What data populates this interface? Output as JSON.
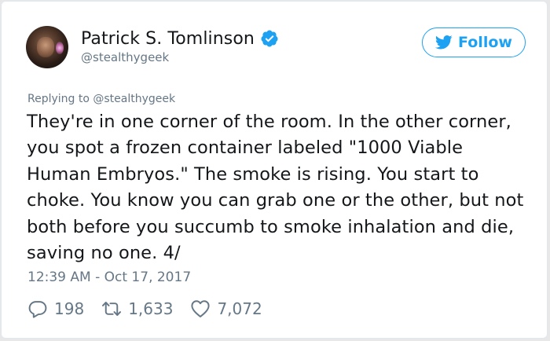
{
  "author": {
    "name": "Patrick S. Tomlinson",
    "handle": "@stealthygeek",
    "verified": true
  },
  "follow_button": {
    "label": "Follow",
    "icon": "twitter-bird-icon"
  },
  "reply": {
    "prefix": "Replying to ",
    "mention": "@stealthygeek"
  },
  "tweet": {
    "text": "They're in one corner of the room. In the other corner, you spot a frozen container labeled \"1000 Viable Human Embryos.\" The smoke is rising. You start to choke. You know you can grab one or the other, but not both before you succumb to smoke inhalation and die, saving no one. 4/",
    "timestamp": "12:39 AM - Oct 17, 2017"
  },
  "stats": {
    "replies": "198",
    "retweets": "1,633",
    "likes": "7,072"
  },
  "icons": {
    "reply": "reply-icon",
    "retweet": "retweet-icon",
    "like": "heart-icon",
    "verified": "verified-badge-icon"
  },
  "colors": {
    "brand_blue": "#1da1f2",
    "text": "#14171a",
    "muted": "#657786",
    "border": "#e1e8ed"
  }
}
